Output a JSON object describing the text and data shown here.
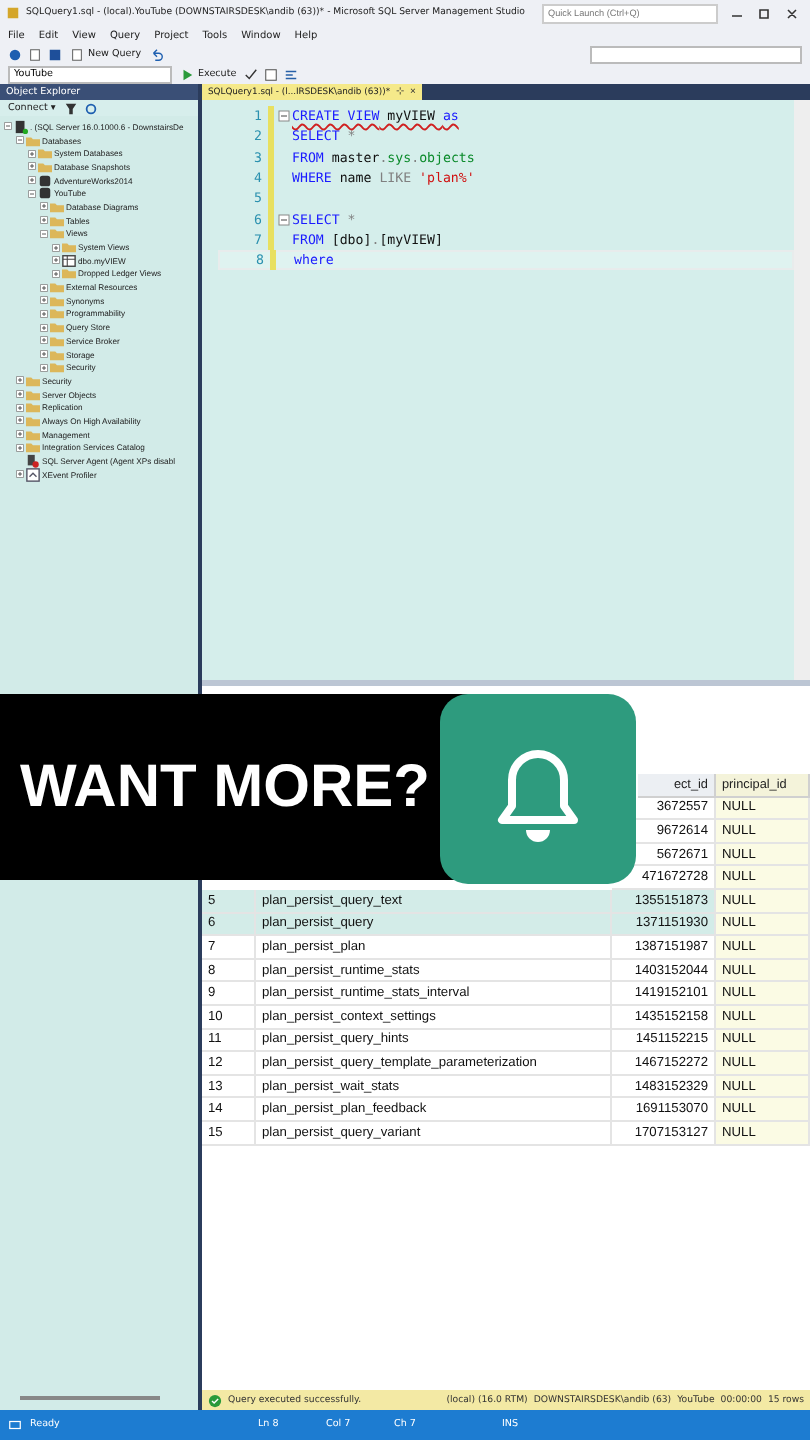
{
  "window": {
    "title": "SQLQuery1.sql - (local).YouTube (DOWNSTAIRSDESK\\andib (63))* - Microsoft SQL Server Management Studio",
    "quick_launch": {
      "placeholder": "Quick Launch (Ctrl+Q)"
    }
  },
  "menu": [
    "File",
    "Edit",
    "View",
    "Query",
    "Project",
    "Tools",
    "Window",
    "Help"
  ],
  "toolbar": {
    "new_query": "New Query",
    "database": "YouTube",
    "execute": "Execute"
  },
  "object_explorer": {
    "title": "Object Explorer",
    "connect": "Connect ▾",
    "tree": [
      {
        "label": ". (SQL Server 16.0.1000.6 - DownstairsDe",
        "kind": "server",
        "expanded": true,
        "children": [
          {
            "label": "Databases",
            "kind": "folder",
            "expanded": true,
            "children": [
              {
                "label": "System Databases",
                "kind": "folder",
                "expanded": false
              },
              {
                "label": "Database Snapshots",
                "kind": "folder",
                "expanded": false
              },
              {
                "label": "AdventureWorks2014",
                "kind": "database",
                "expanded": false
              },
              {
                "label": "YouTube",
                "kind": "database",
                "expanded": true,
                "children": [
                  {
                    "label": "Database Diagrams",
                    "kind": "folder",
                    "expanded": false
                  },
                  {
                    "label": "Tables",
                    "kind": "folder",
                    "expanded": false
                  },
                  {
                    "label": "Views",
                    "kind": "folder",
                    "expanded": true,
                    "children": [
                      {
                        "label": "System Views",
                        "kind": "folder",
                        "expanded": false
                      },
                      {
                        "label": "dbo.myVIEW",
                        "kind": "view",
                        "expanded": false
                      },
                      {
                        "label": "Dropped Ledger Views",
                        "kind": "folder",
                        "expanded": false
                      }
                    ]
                  },
                  {
                    "label": "External Resources",
                    "kind": "folder",
                    "expanded": false
                  },
                  {
                    "label": "Synonyms",
                    "kind": "folder",
                    "expanded": false
                  },
                  {
                    "label": "Programmability",
                    "kind": "folder",
                    "expanded": false
                  },
                  {
                    "label": "Query Store",
                    "kind": "folder",
                    "expanded": false
                  },
                  {
                    "label": "Service Broker",
                    "kind": "folder",
                    "expanded": false
                  },
                  {
                    "label": "Storage",
                    "kind": "folder",
                    "expanded": false
                  },
                  {
                    "label": "Security",
                    "kind": "folder",
                    "expanded": false
                  }
                ]
              }
            ]
          },
          {
            "label": "Security",
            "kind": "folder",
            "expanded": false
          },
          {
            "label": "Server Objects",
            "kind": "folder",
            "expanded": false
          },
          {
            "label": "Replication",
            "kind": "folder",
            "expanded": false
          },
          {
            "label": "Always On High Availability",
            "kind": "folder",
            "expanded": false
          },
          {
            "label": "Management",
            "kind": "folder",
            "expanded": false
          },
          {
            "label": "Integration Services Catalog",
            "kind": "folder",
            "expanded": false
          },
          {
            "label": "SQL Server Agent (Agent XPs disabl",
            "kind": "agent"
          },
          {
            "label": "XEvent Profiler",
            "kind": "profiler",
            "expanded": false
          }
        ]
      }
    ]
  },
  "editor": {
    "tab": "SQLQuery1.sql - (l...IRSDESK\\andib (63))*",
    "pin": "⊹",
    "close": "×",
    "lines": [
      {
        "number": "1",
        "fold": true,
        "squiggle": true,
        "tokens": [
          {
            "kind": "keyword",
            "text": "CREATE VIEW"
          },
          {
            "kind": "plain",
            "text": " myVIEW "
          },
          {
            "kind": "keyword",
            "text": "as"
          }
        ]
      },
      {
        "number": "2",
        "tokens": [
          {
            "kind": "keyword",
            "text": "SELECT"
          },
          {
            "kind": "operator",
            "text": " *"
          }
        ]
      },
      {
        "number": "3",
        "tokens": [
          {
            "kind": "keyword",
            "text": "FROM"
          },
          {
            "kind": "plain",
            "text": " master"
          },
          {
            "kind": "operator",
            "text": "."
          },
          {
            "kind": "system",
            "text": "sys"
          },
          {
            "kind": "operator",
            "text": "."
          },
          {
            "kind": "system",
            "text": "objects"
          }
        ]
      },
      {
        "number": "4",
        "tokens": [
          {
            "kind": "keyword",
            "text": "WHERE"
          },
          {
            "kind": "plain",
            "text": " name "
          },
          {
            "kind": "operator",
            "text": "LIKE"
          },
          {
            "kind": "string",
            "text": " 'plan%'"
          }
        ]
      },
      {
        "number": "5"
      },
      {
        "number": "6",
        "fold": true,
        "tokens": [
          {
            "kind": "keyword",
            "text": "SELECT"
          },
          {
            "kind": "operator",
            "text": " *"
          }
        ]
      },
      {
        "number": "7",
        "tokens": [
          {
            "kind": "keyword",
            "text": "FROM"
          },
          {
            "kind": "plain",
            "text": " [dbo]"
          },
          {
            "kind": "operator",
            "text": "."
          },
          {
            "kind": "plain",
            "text": "[myVIEW]"
          }
        ]
      },
      {
        "number": "8",
        "current": true,
        "tokens": [
          {
            "kind": "keyword",
            "text": "where"
          }
        ]
      }
    ]
  },
  "promo": {
    "text": "WANT MORE?"
  },
  "results": {
    "columns": [
      {
        "label": "ect_id",
        "selected": false
      },
      {
        "label": "principal_id",
        "selected": true
      }
    ],
    "rows": [
      {
        "object_id": "3672557",
        "principal_id": "NULL",
        "selected": false
      },
      {
        "object_id": "9672614",
        "principal_id": "NULL",
        "selected": false
      },
      {
        "object_id": "5672671",
        "principal_id": "NULL",
        "selected": false
      },
      {
        "object_id": "471672728",
        "principal_id": "NULL",
        "selected": false
      },
      {
        "number": "5",
        "name": "plan_persist_query_text",
        "object_id": "1355151873",
        "principal_id": "NULL",
        "selected": true
      },
      {
        "number": "6",
        "name": "plan_persist_query",
        "object_id": "1371151930",
        "principal_id": "NULL",
        "selected": true
      },
      {
        "number": "7",
        "name": "plan_persist_plan",
        "object_id": "1387151987",
        "principal_id": "NULL",
        "selected": false
      },
      {
        "number": "8",
        "name": "plan_persist_runtime_stats",
        "object_id": "1403152044",
        "principal_id": "NULL",
        "selected": false
      },
      {
        "number": "9",
        "name": "plan_persist_runtime_stats_interval",
        "object_id": "1419152101",
        "principal_id": "NULL",
        "selected": false
      },
      {
        "number": "10",
        "name": "plan_persist_context_settings",
        "object_id": "1435152158",
        "principal_id": "NULL",
        "selected": false
      },
      {
        "number": "11",
        "name": "plan_persist_query_hints",
        "object_id": "1451152215",
        "principal_id": "NULL",
        "selected": false
      },
      {
        "number": "12",
        "name": "plan_persist_query_template_parameterization",
        "object_id": "1467152272",
        "principal_id": "NULL",
        "selected": false
      },
      {
        "number": "13",
        "name": "plan_persist_wait_stats",
        "object_id": "1483152329",
        "principal_id": "NULL",
        "selected": false
      },
      {
        "number": "14",
        "name": "plan_persist_plan_feedback",
        "object_id": "1691153070",
        "principal_id": "NULL",
        "selected": false
      },
      {
        "number": "15",
        "name": "plan_persist_query_variant",
        "object_id": "1707153127",
        "principal_id": "NULL",
        "selected": false
      }
    ]
  },
  "query_status": {
    "message": "Query executed successfully.",
    "server": "(local) (16.0 RTM)",
    "user": "DOWNSTAIRSDESK\\andib (63)",
    "database": "YouTube",
    "time": "00:00:00",
    "rows": "15 rows"
  },
  "status_bar": {
    "state": "Ready",
    "line": "Ln 8",
    "col": "Col 7",
    "ch": "Ch 7",
    "mode": "INS"
  }
}
